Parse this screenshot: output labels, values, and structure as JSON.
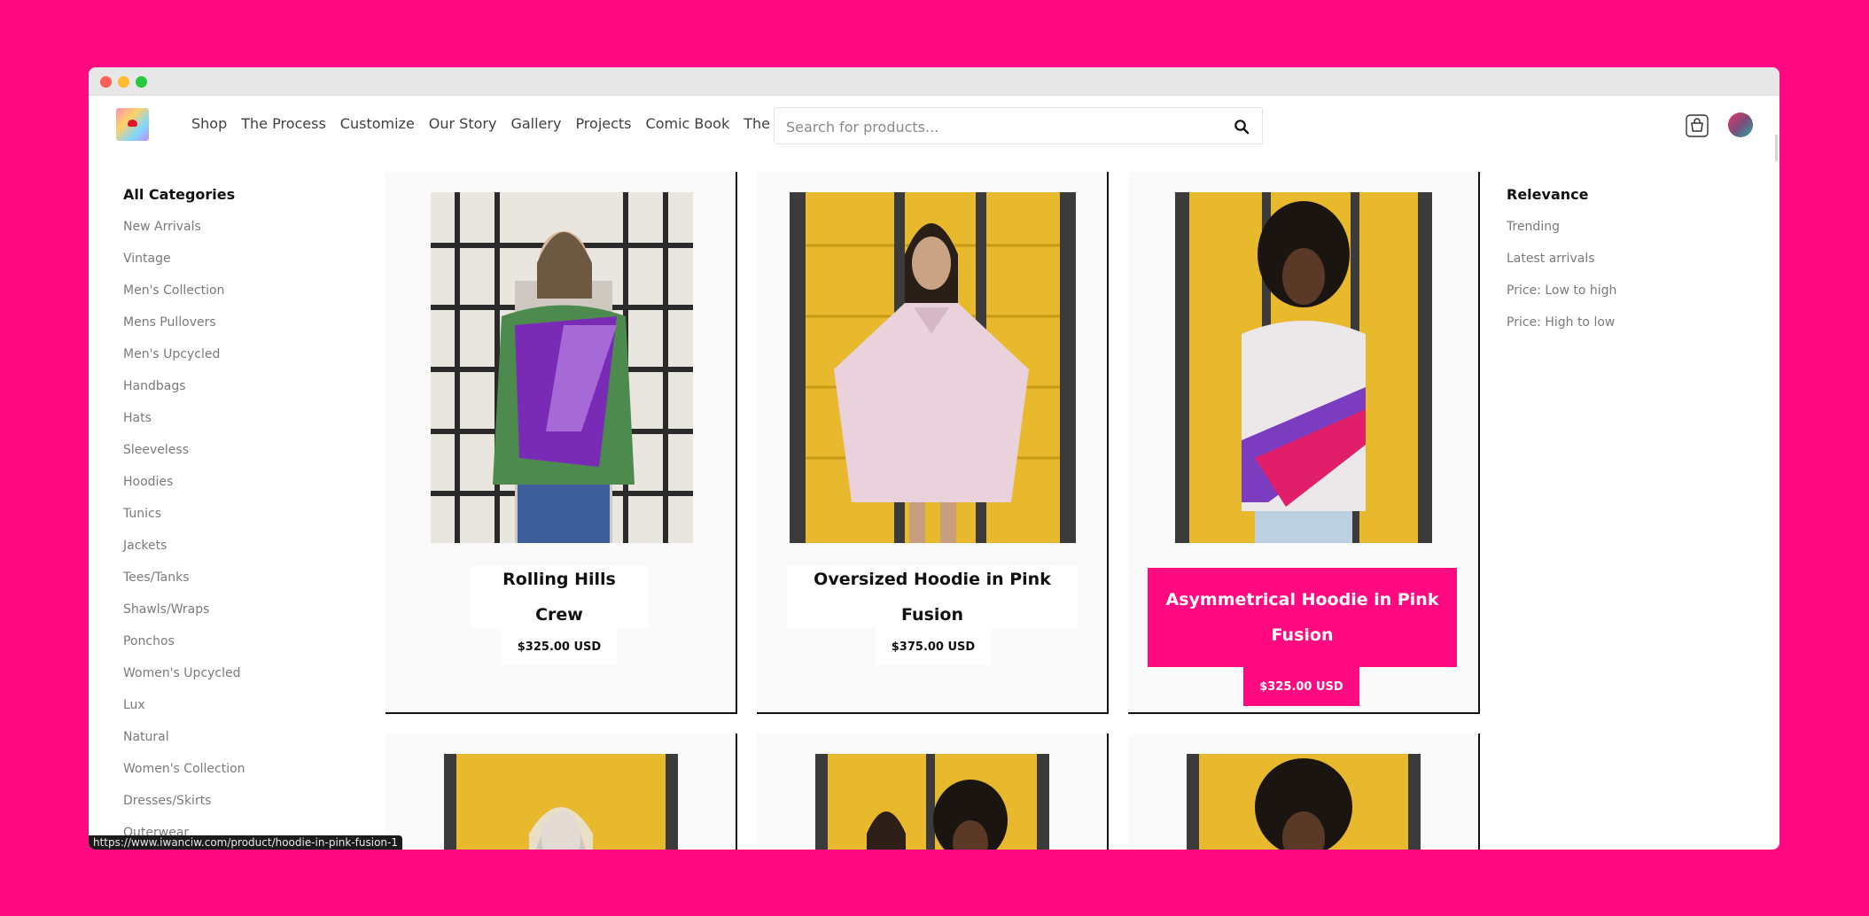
{
  "window": {
    "controls": [
      "close",
      "minimize",
      "zoom"
    ]
  },
  "header": {
    "logo": "logo",
    "nav": [
      "Shop",
      "The Process",
      "Customize",
      "Our Story",
      "Gallery",
      "Projects",
      "Comic Book",
      "The Village"
    ],
    "search": {
      "placeholder": "Search for products...",
      "value": ""
    },
    "cart_icon": "shopping-bag-icon",
    "avatar": "user-avatar"
  },
  "categories": {
    "title": "All Categories",
    "items": [
      "New Arrivals",
      "Vintage",
      "Men's Collection",
      "Mens Pullovers",
      "Men's Upcycled",
      "Handbags",
      "Hats",
      "Sleeveless",
      "Hoodies",
      "Tunics",
      "Jackets",
      "Tees/Tanks",
      "Shawls/Wraps",
      "Ponchos",
      "Women's Upcycled",
      "Lux",
      "Natural",
      "Women's Collection",
      "Dresses/Skirts",
      "Outerwear"
    ]
  },
  "sort": {
    "title": "Relevance",
    "items": [
      "Trending",
      "Latest arrivals",
      "Price: Low to high",
      "Price: High to low"
    ]
  },
  "products": [
    {
      "name": "Rolling Hills Crew",
      "price": "$325.00 USD",
      "active": false
    },
    {
      "name": "Oversized Hoodie in Pink Fusion",
      "price": "$375.00 USD",
      "active": false
    },
    {
      "name": "Asymmetrical Hoodie in Pink Fusion",
      "price": "$325.00 USD",
      "active": true
    },
    {
      "name": "",
      "price": "",
      "active": false
    },
    {
      "name": "",
      "price": "",
      "active": false
    },
    {
      "name": "",
      "price": "",
      "active": false
    }
  ],
  "status_bar": {
    "url": "https://www.iwanciw.com/product/hoodie-in-pink-fusion-1"
  },
  "colors": {
    "accent": "#ff0a80",
    "background": "#ff0a80"
  }
}
